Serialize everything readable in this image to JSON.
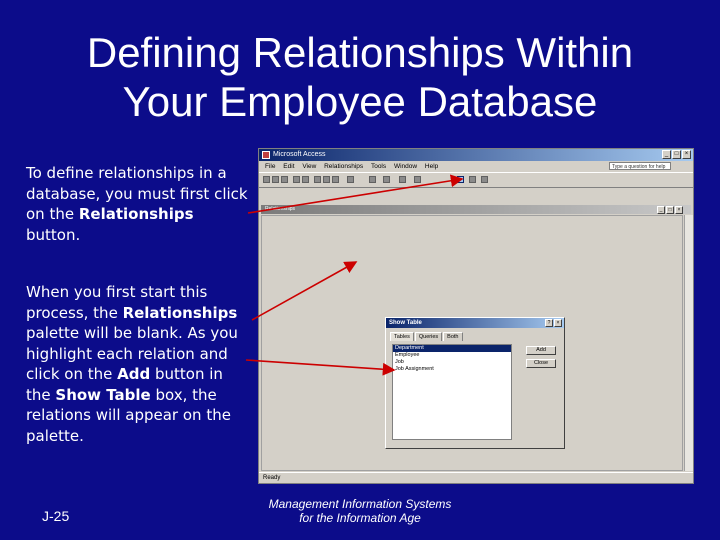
{
  "slide": {
    "title_line1": "Defining Relationships Within",
    "title_line2": "Your Employee Database",
    "para1": {
      "text_a": "To define relationships in a database, you must first click on the ",
      "bold_a": "Relationships",
      "text_b": " button."
    },
    "para2": {
      "text_a": "When you first start this process, the ",
      "bold_a": "Relationships",
      "text_b": " palette will be blank.  As you highlight each relation and click on the ",
      "bold_b": "Add",
      "text_c": " button in the ",
      "bold_c": "Show Table",
      "text_d": " box, the relations will appear on the palette."
    },
    "footer_left": "J-25",
    "footer_mid_line1": "Management Information Systems",
    "footer_mid_line2": "for the Information Age",
    "arrow_color": "#cc0000",
    "background_color": "#0c0c8a"
  },
  "access": {
    "title": "Microsoft Access",
    "menu": [
      "File",
      "Edit",
      "View",
      "Relationships",
      "Tools",
      "Window",
      "Help"
    ],
    "help_placeholder": "Type a question for help",
    "inner_title": "Relationships",
    "status": "Ready",
    "dialog": {
      "title": "Show Table",
      "tabs": [
        "Tables",
        "Queries",
        "Both"
      ],
      "items": [
        "Department",
        "Employee",
        "Job",
        "Job Assignment"
      ],
      "add_label": "Add",
      "close_label": "Close"
    }
  }
}
